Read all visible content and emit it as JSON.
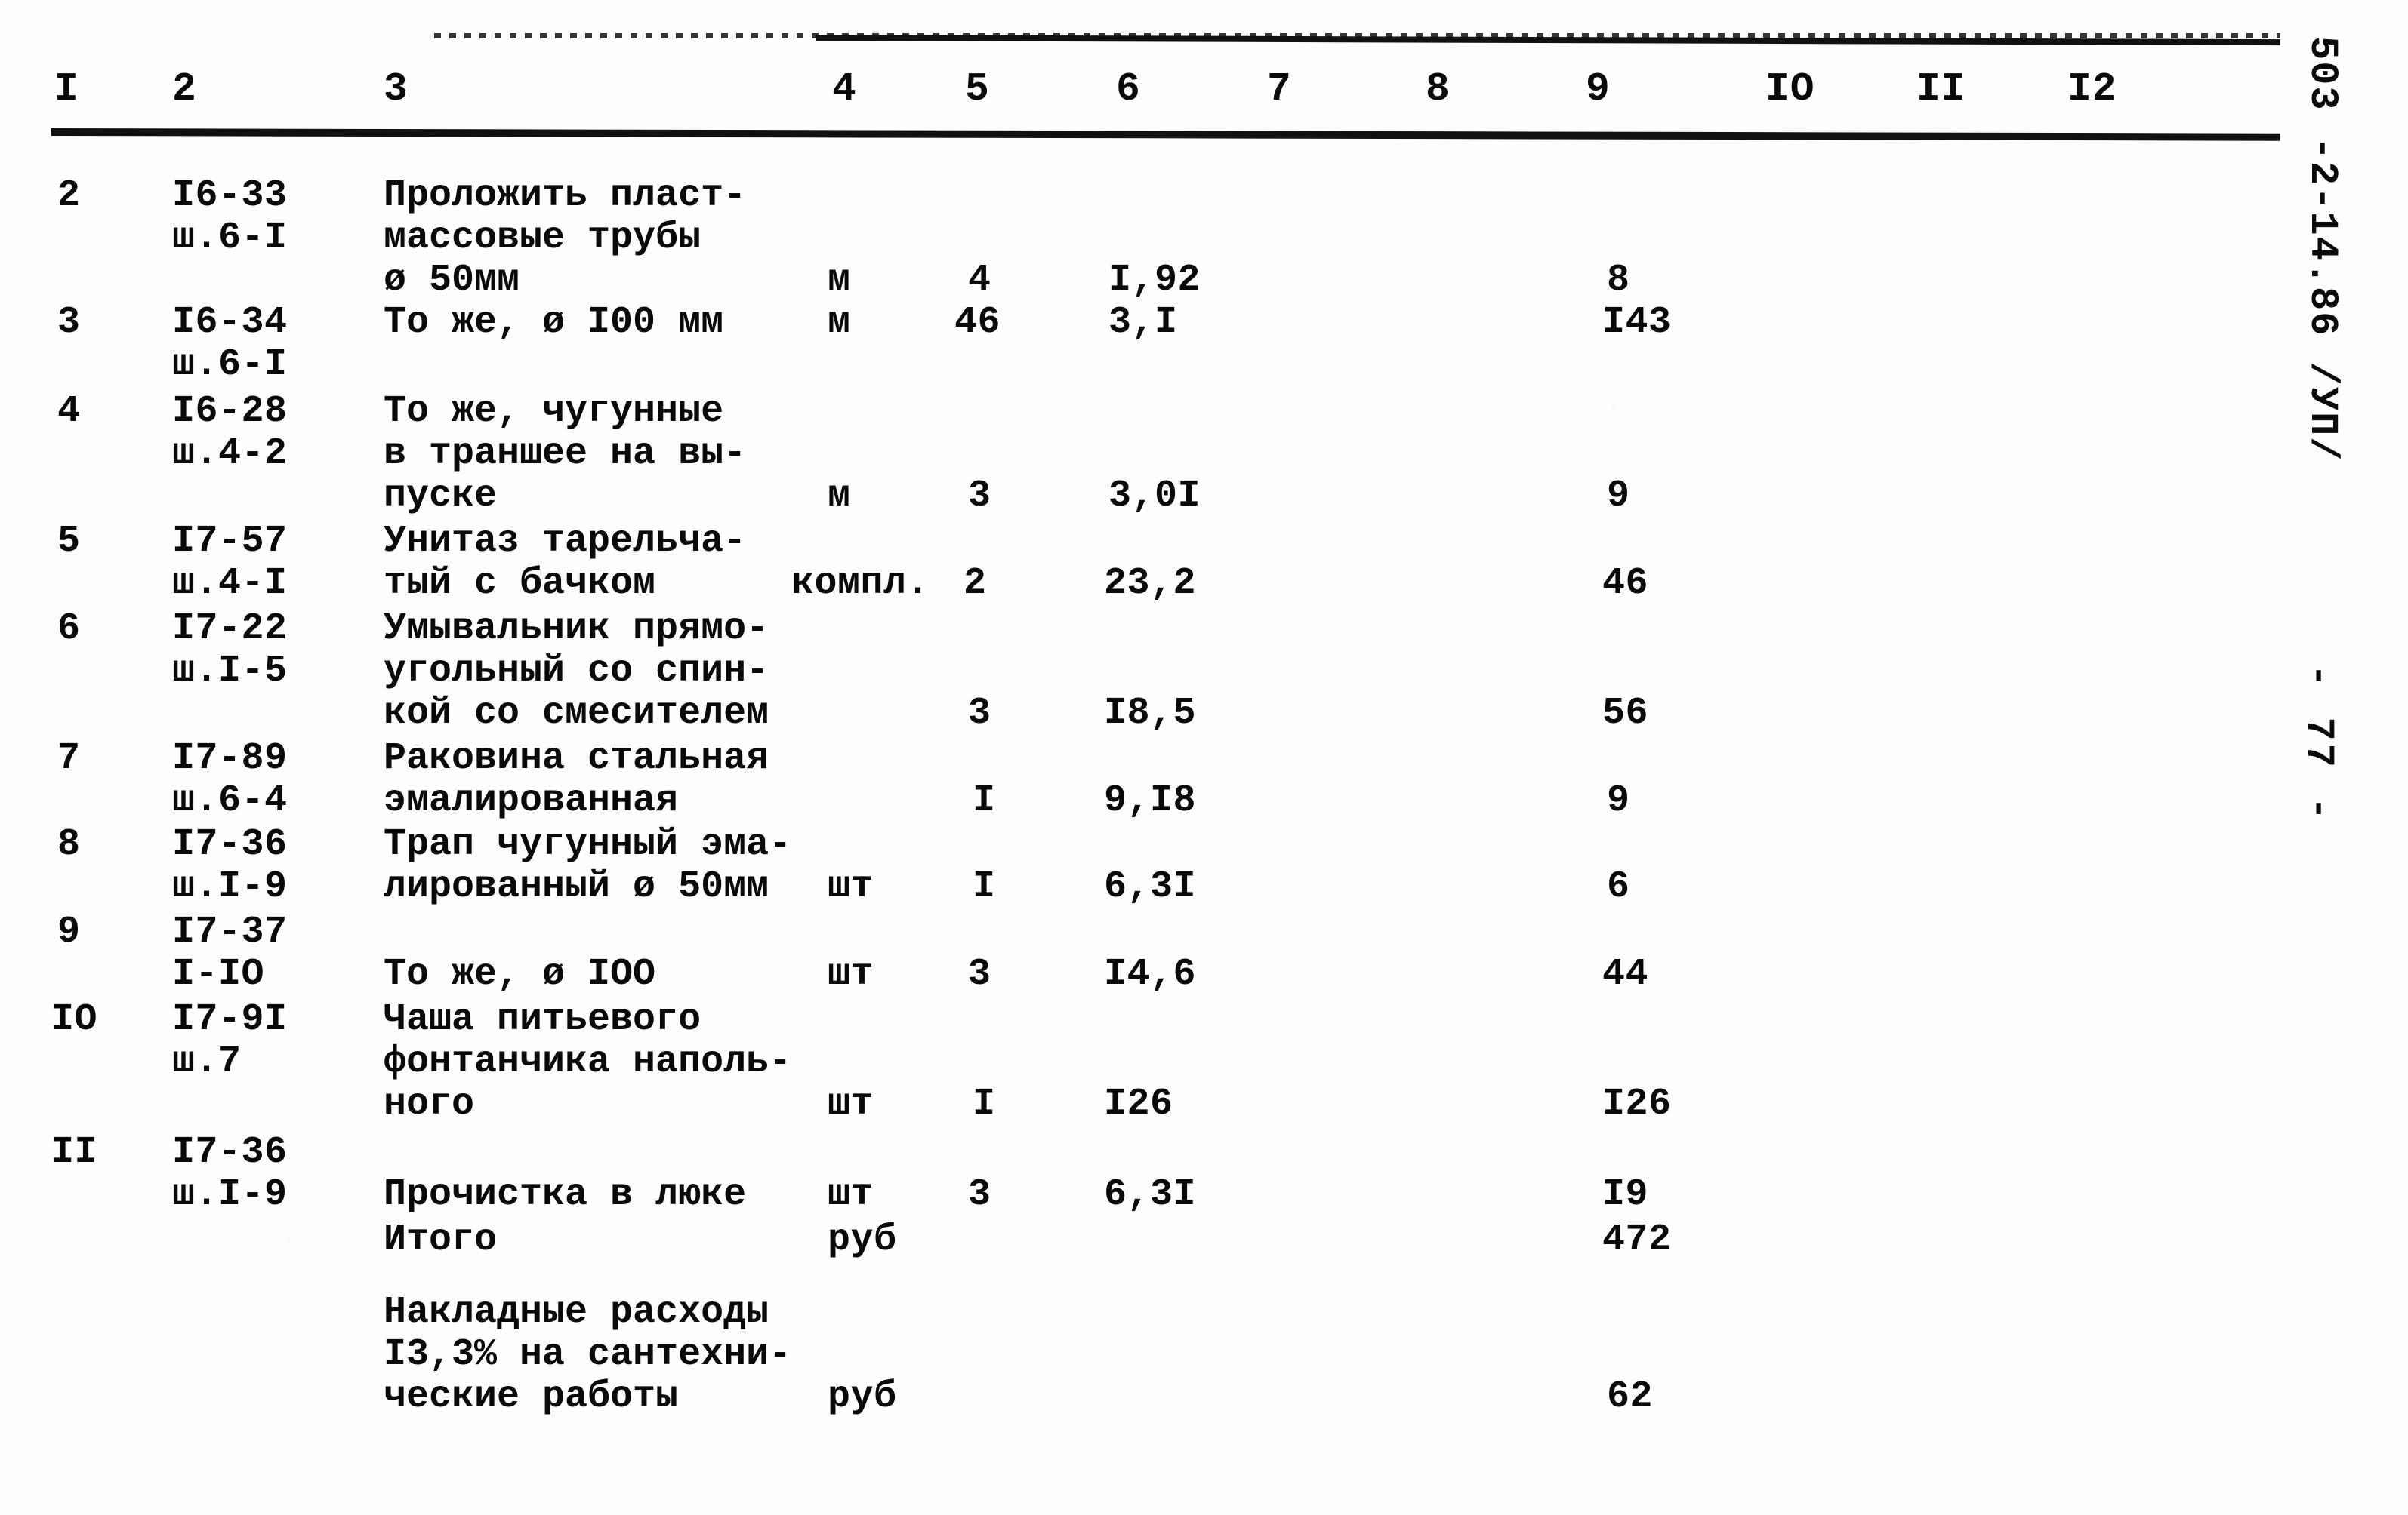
{
  "document": {
    "margin_code": "503 -2-14.86 /УП/",
    "page_number": "- 77 -"
  },
  "table": {
    "column_headers": [
      "I",
      "2",
      "3",
      "4",
      "5",
      "6",
      "7",
      "8",
      "9",
      "IO",
      "II",
      "I2"
    ],
    "rows": [
      {
        "num": "2",
        "code_line1": "I6-33",
        "code_line2": "ш.6-I",
        "desc": "Проложить пласт-\nмассовые трубы\nø 50мм",
        "unit": "м",
        "qty": "4",
        "price": "I,92",
        "col7": "",
        "col8": "",
        "total": "8",
        "col10": "",
        "col11": "",
        "col12": ""
      },
      {
        "num": "3",
        "code_line1": "I6-34",
        "code_line2": "ш.6-I",
        "desc": "То же, ø I00 мм",
        "unit": "м",
        "qty": "46",
        "price": "3,I",
        "col7": "",
        "col8": "",
        "total": "I43",
        "col10": "",
        "col11": "",
        "col12": ""
      },
      {
        "num": "4",
        "code_line1": "I6-28",
        "code_line2": "ш.4-2",
        "desc": "То же, чугунные\nв траншее на вы-\nпуске",
        "unit": "м",
        "qty": "3",
        "price": "3,0I",
        "col7": "",
        "col8": "",
        "total": "9",
        "col10": "",
        "col11": "",
        "col12": ""
      },
      {
        "num": "5",
        "code_line1": "I7-57",
        "code_line2": "ш.4-I",
        "desc": "Унитаз тарельча-\nтый с бачком",
        "unit": "компл.",
        "qty": "2",
        "price": "23,2",
        "col7": "",
        "col8": "",
        "total": "46",
        "col10": "",
        "col11": "",
        "col12": ""
      },
      {
        "num": "6",
        "code_line1": "I7-22",
        "code_line2": "ш.I-5",
        "desc": "Умывальник прямо-\nугольный со спин-\nкой со смесителем",
        "unit": "",
        "qty": "3",
        "price": "I8,5",
        "col7": "",
        "col8": "",
        "total": "56",
        "col10": "",
        "col11": "",
        "col12": ""
      },
      {
        "num": "7",
        "code_line1": "I7-89",
        "code_line2": "ш.6-4",
        "desc": "Раковина стальная\nэмалированная",
        "unit": "",
        "qty": "I",
        "price": "9,I8",
        "col7": "",
        "col8": "",
        "total": "9",
        "col10": "",
        "col11": "",
        "col12": ""
      },
      {
        "num": "8",
        "code_line1": "I7-36",
        "code_line2": "ш.I-9",
        "desc": "Трап чугунный эма-\nлированный ø 50мм",
        "unit": "шт",
        "qty": "I",
        "price": "6,3I",
        "col7": "",
        "col8": "",
        "total": "6",
        "col10": "",
        "col11": "",
        "col12": ""
      },
      {
        "num": "9",
        "code_line1": "I7-37",
        "code_line2": "I-IO",
        "desc": "То же, ø IOO",
        "unit": "шт",
        "qty": "3",
        "price": "I4,6",
        "col7": "",
        "col8": "",
        "total": "44",
        "col10": "",
        "col11": "",
        "col12": ""
      },
      {
        "num": "IO",
        "code_line1": "I7-9I",
        "code_line2": "ш.7",
        "desc": "Чаша питьевого\nфонтанчика наполь-\nного",
        "unit": "шт",
        "qty": "I",
        "price": "I26",
        "col7": "",
        "col8": "",
        "total": "I26",
        "col10": "",
        "col11": "",
        "col12": ""
      },
      {
        "num": "II",
        "code_line1": "I7-36",
        "code_line2": "ш.I-9",
        "desc": "Прочистка в люке",
        "unit": "шт",
        "qty": "3",
        "price": "6,3I",
        "col7": "",
        "col8": "",
        "total": "I9",
        "col10": "",
        "col11": "",
        "col12": ""
      }
    ],
    "summary_rows": [
      {
        "num": "",
        "code_line1": "",
        "code_line2": "",
        "desc": "Итого",
        "unit": "руб",
        "qty": "",
        "price": "",
        "total": "472"
      },
      {
        "num": "",
        "code_line1": "",
        "code_line2": "",
        "desc": "Накладные расходы\nI3,3% на сантехни-\nческие работы",
        "unit": "руб",
        "qty": "",
        "price": "",
        "total": "62"
      }
    ]
  }
}
